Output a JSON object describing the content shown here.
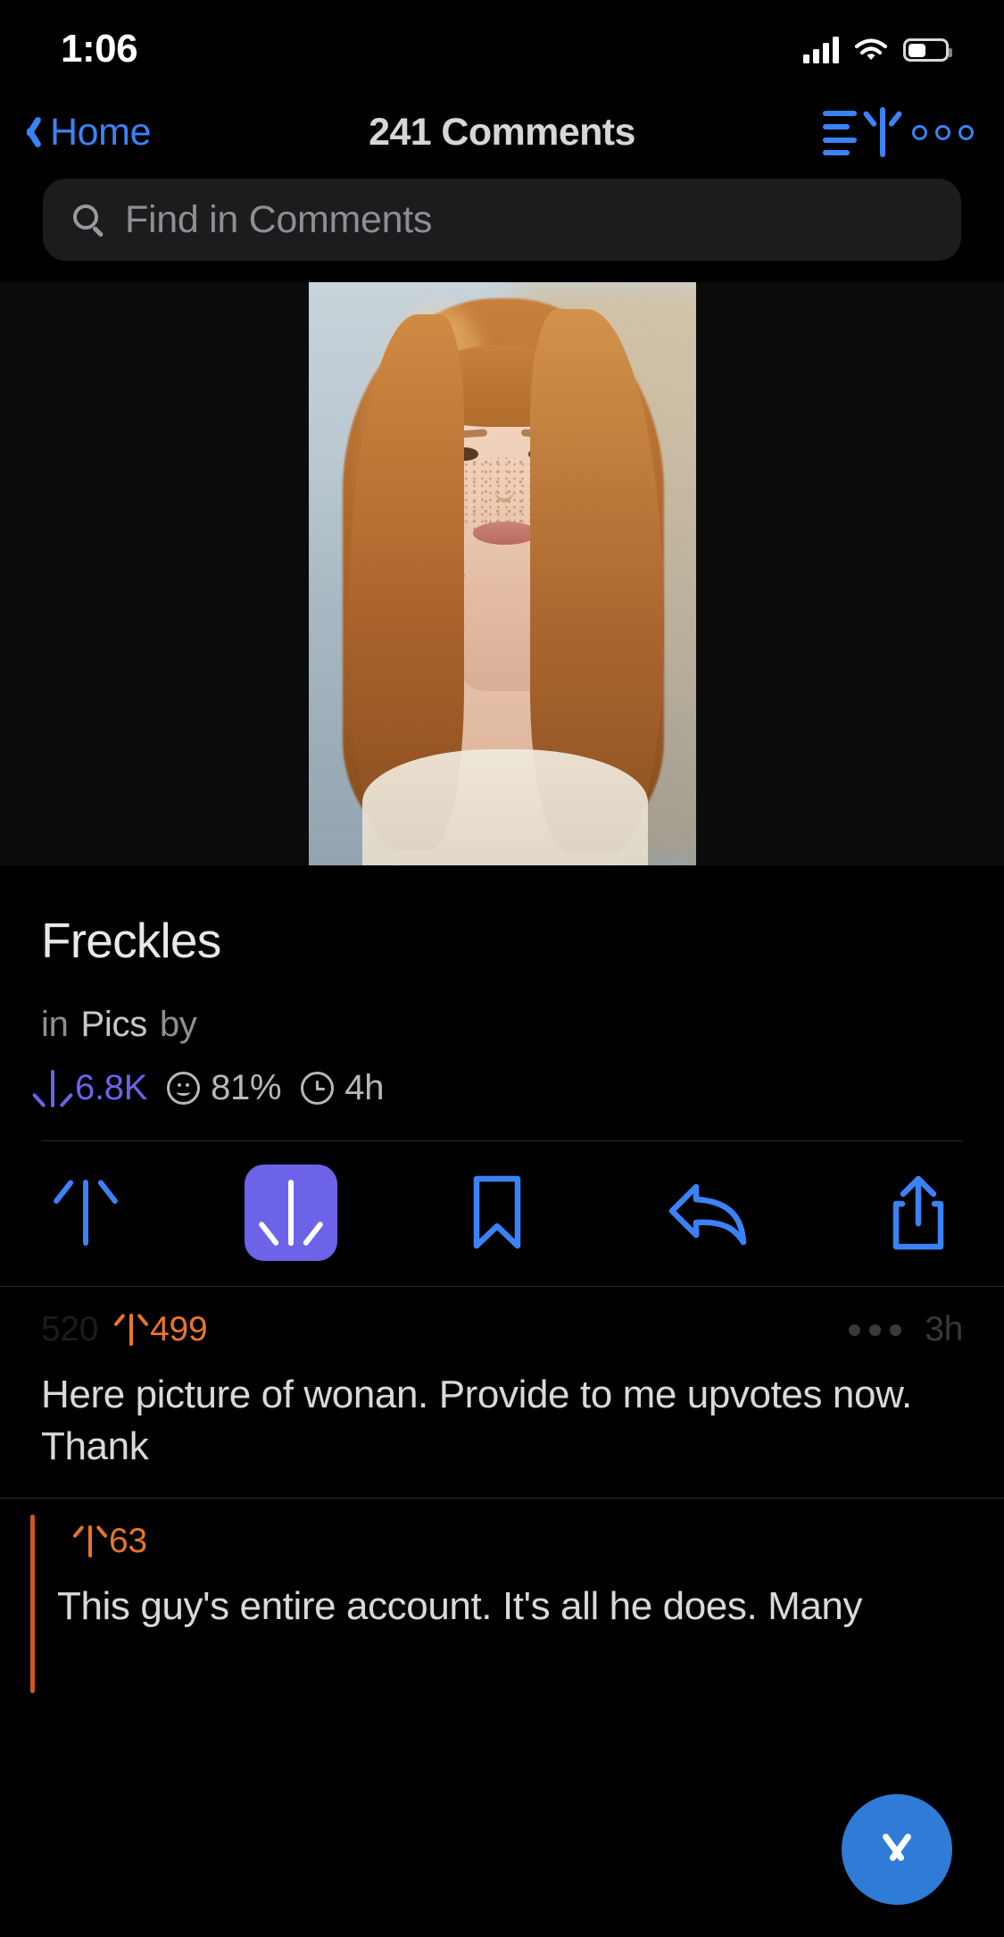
{
  "status_bar": {
    "time": "1:06",
    "cellular_icon": "signal-bars-icon",
    "wifi_icon": "wifi-icon",
    "battery_icon": "battery-icon"
  },
  "nav": {
    "back_icon": "chevron-left-icon",
    "back_label": "Home",
    "title": "241 Comments",
    "sort_icon": "sort-ascending-icon",
    "more_icon": "more-options-icon"
  },
  "search": {
    "icon": "search-icon",
    "placeholder": "Find in Comments",
    "value": ""
  },
  "post": {
    "media_alt": "Portrait photo of a woman with red hair and freckles",
    "title": "Freckles",
    "in_label": "in",
    "subreddit": "Pics",
    "by_label": "by",
    "author": "",
    "score": "6.8K",
    "score_icon": "arrow-down-icon",
    "upvote_ratio": "81%",
    "ratio_icon": "smiley-icon",
    "age": "4h",
    "age_icon": "clock-icon",
    "score_color": "#6c63e8"
  },
  "actions": [
    {
      "name": "upvote-button",
      "icon": "arrow-up-icon",
      "active": false
    },
    {
      "name": "downvote-button",
      "icon": "arrow-down-icon",
      "active": true
    },
    {
      "name": "save-button",
      "icon": "bookmark-icon",
      "active": false
    },
    {
      "name": "reply-button",
      "icon": "reply-arrow-icon",
      "active": false
    },
    {
      "name": "share-button",
      "icon": "share-icon",
      "active": false
    }
  ],
  "comments": [
    {
      "author": "",
      "author_suffix": "520",
      "score": "499",
      "score_icon": "arrow-up-icon",
      "age": "3h",
      "more_icon": "more-options-icon",
      "body": "Here picture of wonan. Provide to me upvotes now. Thank",
      "nested": false
    },
    {
      "author": "",
      "score": "63",
      "score_icon": "arrow-up-icon",
      "age": "",
      "more_icon": "more-options-icon",
      "body": "This guy's entire account. It's all he does. Many",
      "nested": true,
      "thread_color": "#d2532b"
    }
  ],
  "fab": {
    "icon": "chevron-down-icon",
    "label": "next-comment",
    "color": "#2f7bd6"
  }
}
